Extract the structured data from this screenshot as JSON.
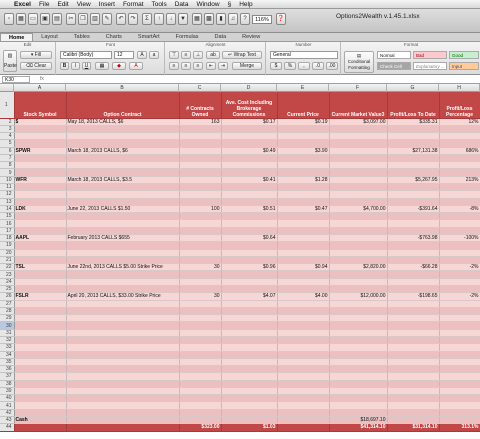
{
  "menubar": {
    "app": "Excel",
    "items": [
      "File",
      "Edit",
      "View",
      "Insert",
      "Format",
      "Tools",
      "Data",
      "Window",
      "Help"
    ]
  },
  "toolbar": {
    "zoom": "116%",
    "filename": "Options2Wealth v.1.45.1.xlsx"
  },
  "ribbon_tabs": [
    "Home",
    "Layout",
    "Tables",
    "Charts",
    "SmartArt",
    "Formulas",
    "Data",
    "Review"
  ],
  "ribbon": {
    "groups": {
      "edit": "Edit",
      "font": "Font",
      "alignment": "Alignment",
      "number": "Number",
      "format": "Format"
    },
    "fill_label": "Fill",
    "clear_label": "Clear",
    "paste_label": "Paste",
    "font_name": "Calibri (Body)",
    "font_size": "12",
    "wrap_label": "Wrap Text",
    "merge_label": "Merge",
    "number_format": "General",
    "cond_label": "Conditional Formatting",
    "styles": {
      "normal": "Normal",
      "bad": "Bad",
      "good": "Good",
      "check": "Check Cell",
      "explanatory": "Explanatory ...",
      "input": "Input"
    }
  },
  "formula_bar": {
    "cell_ref": "K30",
    "fx": "fx"
  },
  "columns": [
    "A",
    "B",
    "C",
    "D",
    "E",
    "F",
    "G",
    "H"
  ],
  "headers": {
    "A": "Stock Symbol",
    "B": "Option Contract",
    "C": "# Contracts Owned",
    "D": "Ave. Cost Including Brokerage Commissions",
    "E": "Current Price",
    "F": "Current Market Value3",
    "G": "Profit/Loss To Date",
    "H": "Profit/Loss Percentage"
  },
  "rows": [
    {
      "n": "2",
      "a": "$",
      "b": "May 18, 2013 CALLS, $6",
      "c": "163",
      "d": "$0.17",
      "e": "$0.19",
      "f": "$3,097.00",
      "g": "$335.31",
      "h": "12%"
    },
    {
      "n": "3"
    },
    {
      "n": "4"
    },
    {
      "n": "5"
    },
    {
      "n": "6",
      "a": "SPWR",
      "b": "March 18, 2013 CALLS, $6",
      "d": "$0.49",
      "e": "$3.90",
      "g": "$27,131.38",
      "h": "686%"
    },
    {
      "n": "7"
    },
    {
      "n": "8"
    },
    {
      "n": "9"
    },
    {
      "n": "10",
      "a": "WFR",
      "b": "March 18, 2013 CALLS, $3.5",
      "d": "$0.41",
      "e": "$1.28",
      "g": "$5,267.95",
      "h": "213%"
    },
    {
      "n": "11"
    },
    {
      "n": "12"
    },
    {
      "n": "13"
    },
    {
      "n": "14",
      "a": "LDK",
      "b": "June 22, 2013 CALLS $1.50",
      "c": "100",
      "d": "$0.51",
      "e": "$0.47",
      "f": "$4,700.00",
      "g": "-$391.64",
      "h": "-8%"
    },
    {
      "n": "15"
    },
    {
      "n": "16"
    },
    {
      "n": "17"
    },
    {
      "n": "18",
      "a": "AAPL",
      "b": "February 2013 CALLS $655",
      "d": "$0.64",
      "g": "-$763.98",
      "h": "-100%"
    },
    {
      "n": "19"
    },
    {
      "n": "20"
    },
    {
      "n": "21"
    },
    {
      "n": "22",
      "a": "TSL",
      "b": "June 22nd, 2013 CALLS $5.00 Strike Price",
      "c": "30",
      "d": "$0.96",
      "e": "$0.94",
      "f": "$2,820.00",
      "g": "-$66.28",
      "h": "-2%"
    },
    {
      "n": "23"
    },
    {
      "n": "24"
    },
    {
      "n": "25"
    },
    {
      "n": "26",
      "a": "FSLR",
      "b": "April 20, 2013 CALLS, $33.00 Strike Price",
      "c": "30",
      "d": "$4.07",
      "e": "$4.00",
      "f": "$12,000.00",
      "g": "-$198.65",
      "h": "-2%"
    },
    {
      "n": "27"
    },
    {
      "n": "28"
    },
    {
      "n": "29"
    },
    {
      "n": "30"
    },
    {
      "n": "31"
    },
    {
      "n": "32"
    },
    {
      "n": "33"
    },
    {
      "n": "34"
    },
    {
      "n": "35"
    },
    {
      "n": "36"
    },
    {
      "n": "37"
    },
    {
      "n": "38"
    },
    {
      "n": "39"
    },
    {
      "n": "40"
    },
    {
      "n": "41"
    },
    {
      "n": "42"
    },
    {
      "n": "43",
      "a": "Cash",
      "f": "$18,697.10"
    },
    {
      "n": "44",
      "c": "$323.00",
      "d": "$1.03",
      "f": "$41,314.10",
      "g": "$31,314.10",
      "h": "313.1%"
    }
  ],
  "colors": {
    "header_red": "#c24848",
    "row_light": "#f7d6d6",
    "row_dark": "#ecc0c0"
  }
}
